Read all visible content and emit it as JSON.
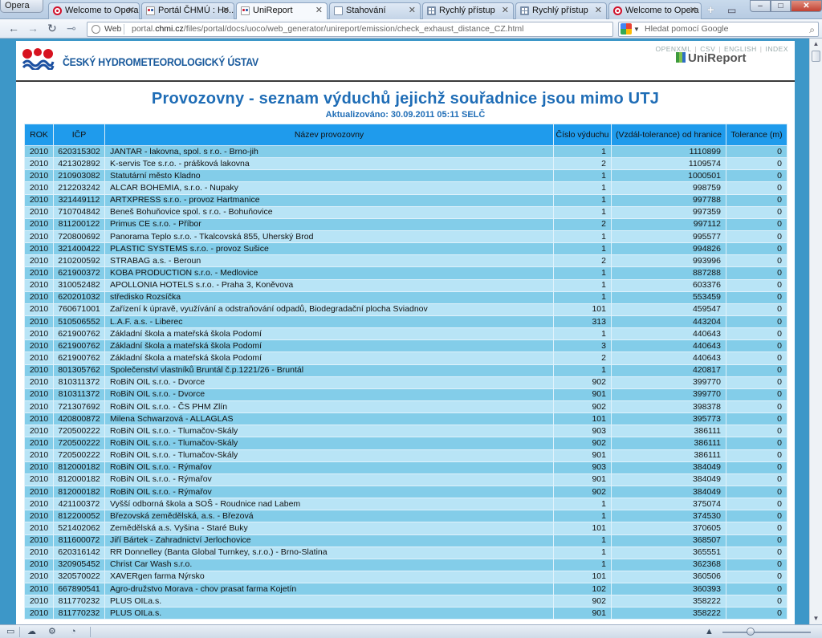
{
  "browser": {
    "menu_label": "Opera",
    "tabs": [
      {
        "title": "Welcome to Opera",
        "icon": "opera-icon",
        "active": false
      },
      {
        "title": "Portál ČHMÚ : Ho...",
        "icon": "chmi-favicon",
        "active": false
      },
      {
        "title": "UniReport",
        "icon": "chmi-favicon",
        "active": true
      },
      {
        "title": "Stahování",
        "icon": "page-icon",
        "active": false
      },
      {
        "title": "Rychlý přístup",
        "icon": "grid-icon",
        "active": false
      },
      {
        "title": "Rychlý přístup",
        "icon": "grid-icon",
        "active": false
      },
      {
        "title": "Welcome to Opera",
        "icon": "opera-icon",
        "active": false
      }
    ],
    "address": {
      "web_label": "Web",
      "url_prefix": "portal.",
      "url_host": "chmi.cz",
      "url_path": "/files/portal/docs/uoco/web_generator/unireport/emission/check_exhaust_distance_CZ.html"
    },
    "search": {
      "placeholder": "Hledat pomocí Google"
    }
  },
  "page": {
    "org_name": "ČESKÝ HYDROMETEOROLOGICKÝ ÚSTAV",
    "top_links": [
      "OPENXML",
      "CSV",
      "ENGLISH",
      "INDEX"
    ],
    "app_name": "UniReport",
    "title": "Provozovny - seznam výduchů jejichž souřadnice jsou mimo UTJ",
    "subtitle": "Aktualizováno: 30.09.2011 05:11 SELČ",
    "table": {
      "headers": [
        "ROK",
        "IČP",
        "Název provozovny",
        "Číslo výduchu",
        "(Vzdál-tolerance) od hranice",
        "Tolerance (m)"
      ],
      "rows": [
        [
          "2010",
          "620315302",
          "JANTAR - lakovna, spol. s r.o. - Brno-jih",
          "1",
          "1110899",
          "0"
        ],
        [
          "2010",
          "421302892",
          "K-servis Tce s.r.o. - prášková lakovna",
          "2",
          "1109574",
          "0"
        ],
        [
          "2010",
          "210903082",
          "Statutární město Kladno",
          "1",
          "1000501",
          "0"
        ],
        [
          "2010",
          "212203242",
          "ALCAR BOHEMIA, s.r.o. - Nupaky",
          "1",
          "998759",
          "0"
        ],
        [
          "2010",
          "321449112",
          "ARTXPRESS s.r.o. - provoz Hartmanice",
          "1",
          "997788",
          "0"
        ],
        [
          "2010",
          "710704842",
          "Beneš Bohuňovice spol. s r.o. - Bohuňovice",
          "1",
          "997359",
          "0"
        ],
        [
          "2010",
          "811200122",
          "Primus CE s.r.o. - Příbor",
          "2",
          "997112",
          "0"
        ],
        [
          "2010",
          "720800692",
          "Panorama Teplo s.r.o. - Tkalcovská 855, Uherský Brod",
          "1",
          "995577",
          "0"
        ],
        [
          "2010",
          "321400422",
          "PLASTIC SYSTEMS s.r.o. - provoz Sušice",
          "1",
          "994826",
          "0"
        ],
        [
          "2010",
          "210200592",
          "STRABAG a.s. - Beroun",
          "2",
          "993996",
          "0"
        ],
        [
          "2010",
          "621900372",
          "KOBA PRODUCTION s.r.o. - Medlovice",
          "1",
          "887288",
          "0"
        ],
        [
          "2010",
          "310052482",
          "APOLLONIA HOTELS s.r.o. - Praha 3, Koněvova",
          "1",
          "603376",
          "0"
        ],
        [
          "2010",
          "620201032",
          "středisko Rozsíčka",
          "1",
          "553459",
          "0"
        ],
        [
          "2010",
          "760671001",
          "Zařízení k úpravě, využívání a odstraňování odpadů, Biodegradační plocha Sviadnov",
          "101",
          "459547",
          "0"
        ],
        [
          "2010",
          "510506552",
          "L.A.F. a.s. - Liberec",
          "313",
          "443204",
          "0"
        ],
        [
          "2010",
          "621900762",
          "Základní škola a mateřská škola Podomí",
          "1",
          "440643",
          "0"
        ],
        [
          "2010",
          "621900762",
          "Základní škola a mateřská škola Podomí",
          "3",
          "440643",
          "0"
        ],
        [
          "2010",
          "621900762",
          "Základní škola a mateřská škola Podomí",
          "2",
          "440643",
          "0"
        ],
        [
          "2010",
          "801305762",
          "Společenství vlastníků Bruntál č.p.1221/26 - Bruntál",
          "1",
          "420817",
          "0"
        ],
        [
          "2010",
          "810311372",
          "RoBiN OIL s.r.o. - Dvorce",
          "902",
          "399770",
          "0"
        ],
        [
          "2010",
          "810311372",
          "RoBiN OIL s.r.o. - Dvorce",
          "901",
          "399770",
          "0"
        ],
        [
          "2010",
          "721307692",
          "RoBiN OIL s.r.o. - ČS PHM Zlín",
          "902",
          "398378",
          "0"
        ],
        [
          "2010",
          "420800872",
          "Milena Schwarzová - ALLAGLAS",
          "101",
          "395773",
          "0"
        ],
        [
          "2010",
          "720500222",
          "RoBiN OIL s.r.o. - Tlumačov-Skály",
          "903",
          "386111",
          "0"
        ],
        [
          "2010",
          "720500222",
          "RoBiN OIL s.r.o. - Tlumačov-Skály",
          "902",
          "386111",
          "0"
        ],
        [
          "2010",
          "720500222",
          "RoBiN OIL s.r.o. - Tlumačov-Skály",
          "901",
          "386111",
          "0"
        ],
        [
          "2010",
          "812000182",
          "RoBiN OIL s.r.o. - Rýmařov",
          "903",
          "384049",
          "0"
        ],
        [
          "2010",
          "812000182",
          "RoBiN OIL s.r.o. - Rýmařov",
          "901",
          "384049",
          "0"
        ],
        [
          "2010",
          "812000182",
          "RoBiN OIL s.r.o. - Rýmařov",
          "902",
          "384049",
          "0"
        ],
        [
          "2010",
          "421100372",
          "Vyšší odborná škola a SOŠ - Roudnice nad Labem",
          "1",
          "375074",
          "0"
        ],
        [
          "2010",
          "812200052",
          "Březovská zemědělská, a.s. - Březová",
          "1",
          "374530",
          "0"
        ],
        [
          "2010",
          "521402062",
          "Zemědělská a.s. Vyšina - Staré Buky",
          "101",
          "370605",
          "0"
        ],
        [
          "2010",
          "811600072",
          "Jiří Bártek - Zahradnictví Jerlochovice",
          "1",
          "368507",
          "0"
        ],
        [
          "2010",
          "620316142",
          "RR Donnelley (Banta Global Turnkey, s.r.o.) - Brno-Slatina",
          "1",
          "365551",
          "0"
        ],
        [
          "2010",
          "320905452",
          "Christ Car Wash s.r.o.",
          "1",
          "362368",
          "0"
        ],
        [
          "2010",
          "320570022",
          "XAVERgen farma Nýrsko",
          "101",
          "360506",
          "0"
        ],
        [
          "2010",
          "667890541",
          "Agro-družstvo Morava - chov prasat farma Kojetín",
          "102",
          "360393",
          "0"
        ],
        [
          "2010",
          "811770232",
          "PLUS OILa.s.",
          "902",
          "358222",
          "0"
        ],
        [
          "2010",
          "811770232",
          "PLUS OILa.s.",
          "901",
          "358222",
          "0"
        ]
      ]
    }
  },
  "colors": {
    "title_blue": "#1f6db6",
    "header_blue": "#1f9bec",
    "row_dark": "#83cde9",
    "row_light": "#b8e4f6",
    "viewport_bg": "#3d97c8"
  }
}
